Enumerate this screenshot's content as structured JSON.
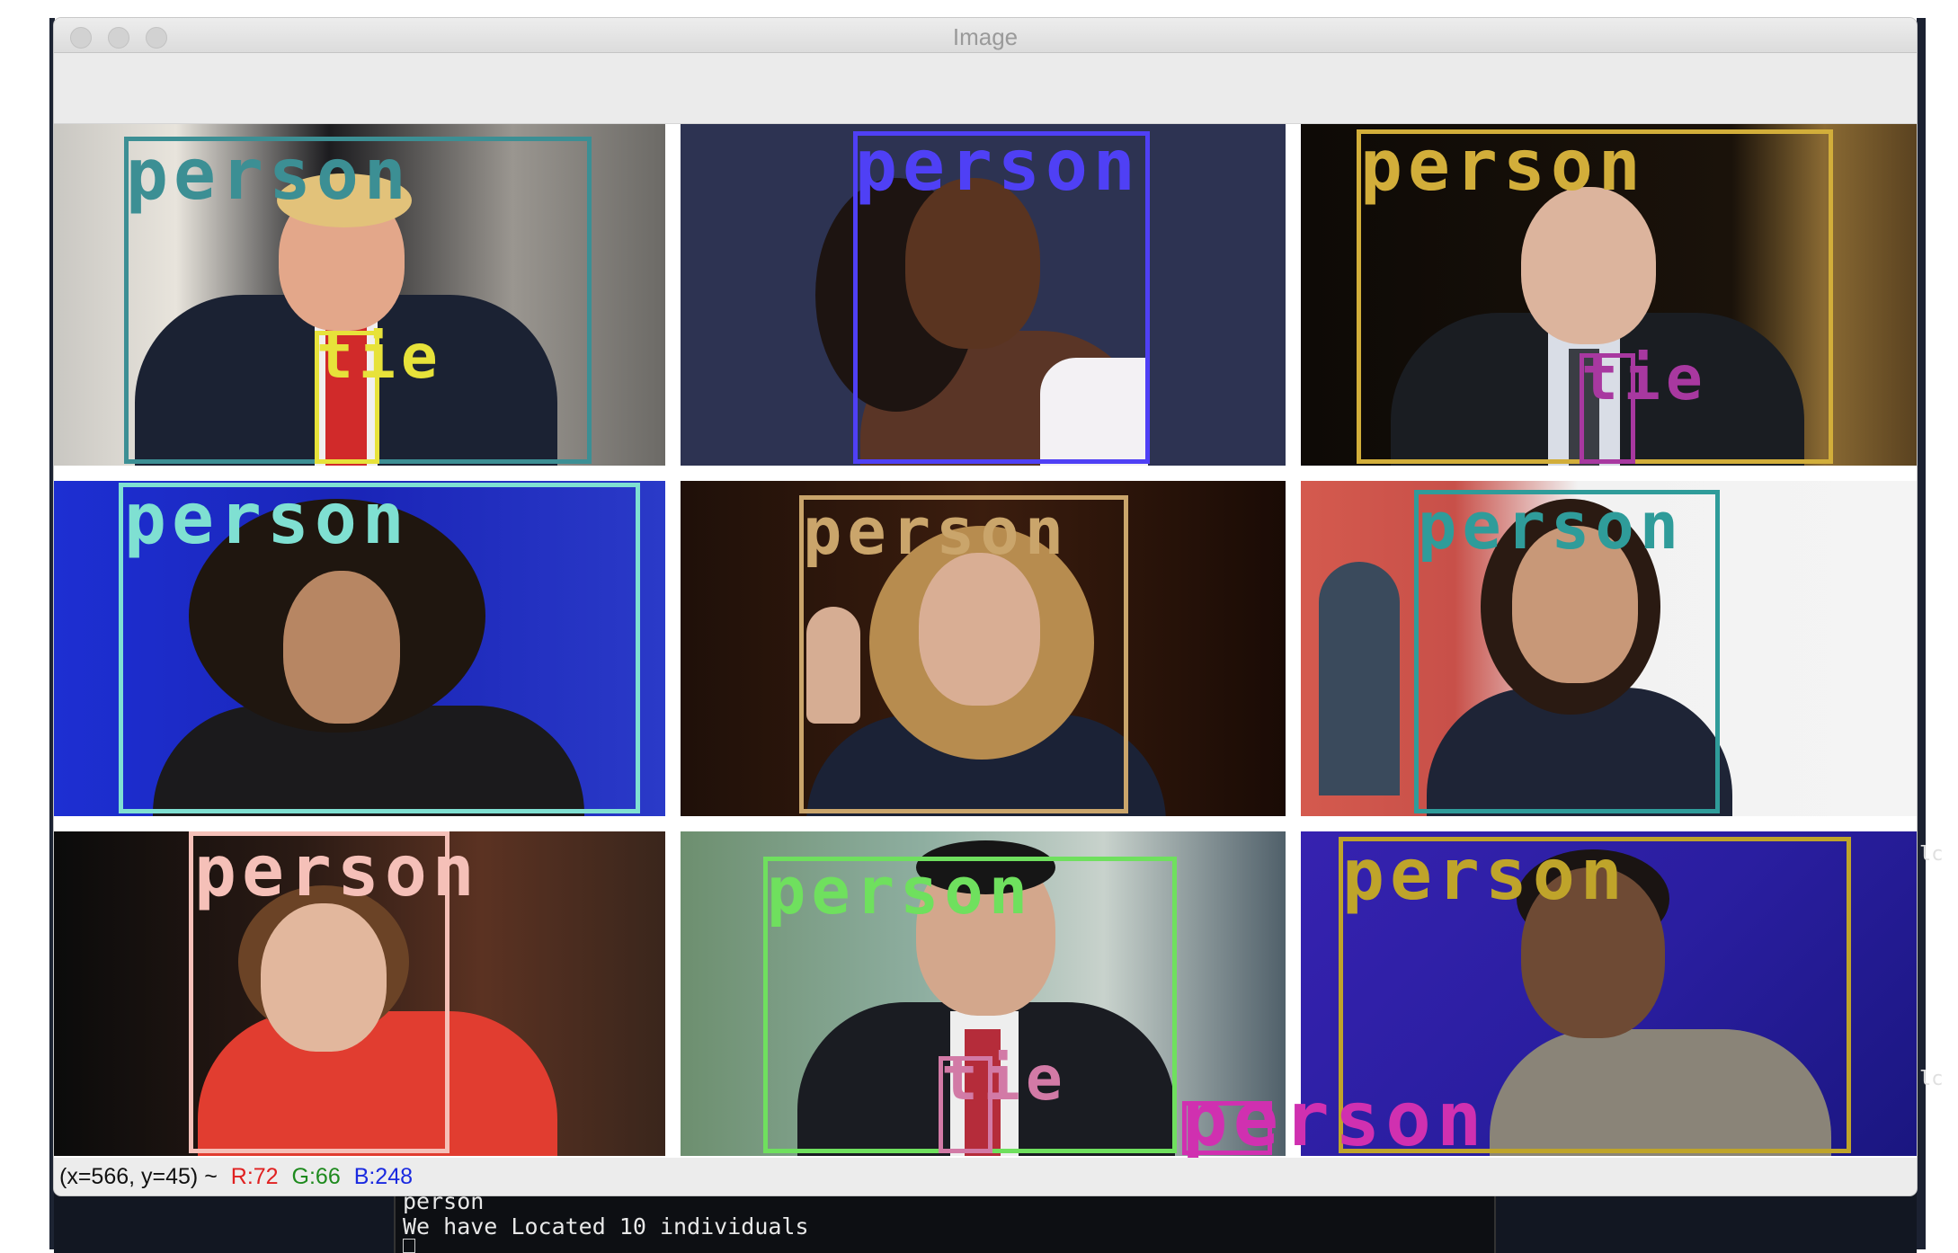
{
  "window": {
    "title": "Image"
  },
  "status_bar": {
    "coords": "(x=566, y=45) ~",
    "r": "R:72",
    "g": "G:66",
    "b": "B:248"
  },
  "terminal": {
    "prev_line": "person",
    "message": "We have Located 10 individuals"
  },
  "desktop": {
    "right_text_1": "lc",
    "right_text_2": "lc"
  },
  "detections": {
    "tile1": {
      "person": "person",
      "tie": "tie",
      "person_color": "#3c8f94",
      "tie_color": "#e7e23a"
    },
    "tile2": {
      "person": "person",
      "person_color": "#4f40f5"
    },
    "tile3": {
      "person": "person",
      "tie": "tie",
      "person_color": "#d2ae3a",
      "tie_color": "#a838a0"
    },
    "tile4": {
      "person": "person",
      "person_color": "#7fe0d2"
    },
    "tile5": {
      "person": "person",
      "person_color": "#caa56b"
    },
    "tile6": {
      "person": "person",
      "person_color": "#2f9c9a"
    },
    "tile7": {
      "person": "person",
      "person_color": "#f5c0b8"
    },
    "tile8": {
      "person": "person",
      "tie": "tie",
      "person_color": "#6fe05e",
      "tie_color": "#d27aa6"
    },
    "tile8_extra": {
      "person": "person",
      "person_color": "#d030b0"
    },
    "tile9": {
      "person": "person",
      "person_color": "#bfa42a"
    }
  }
}
